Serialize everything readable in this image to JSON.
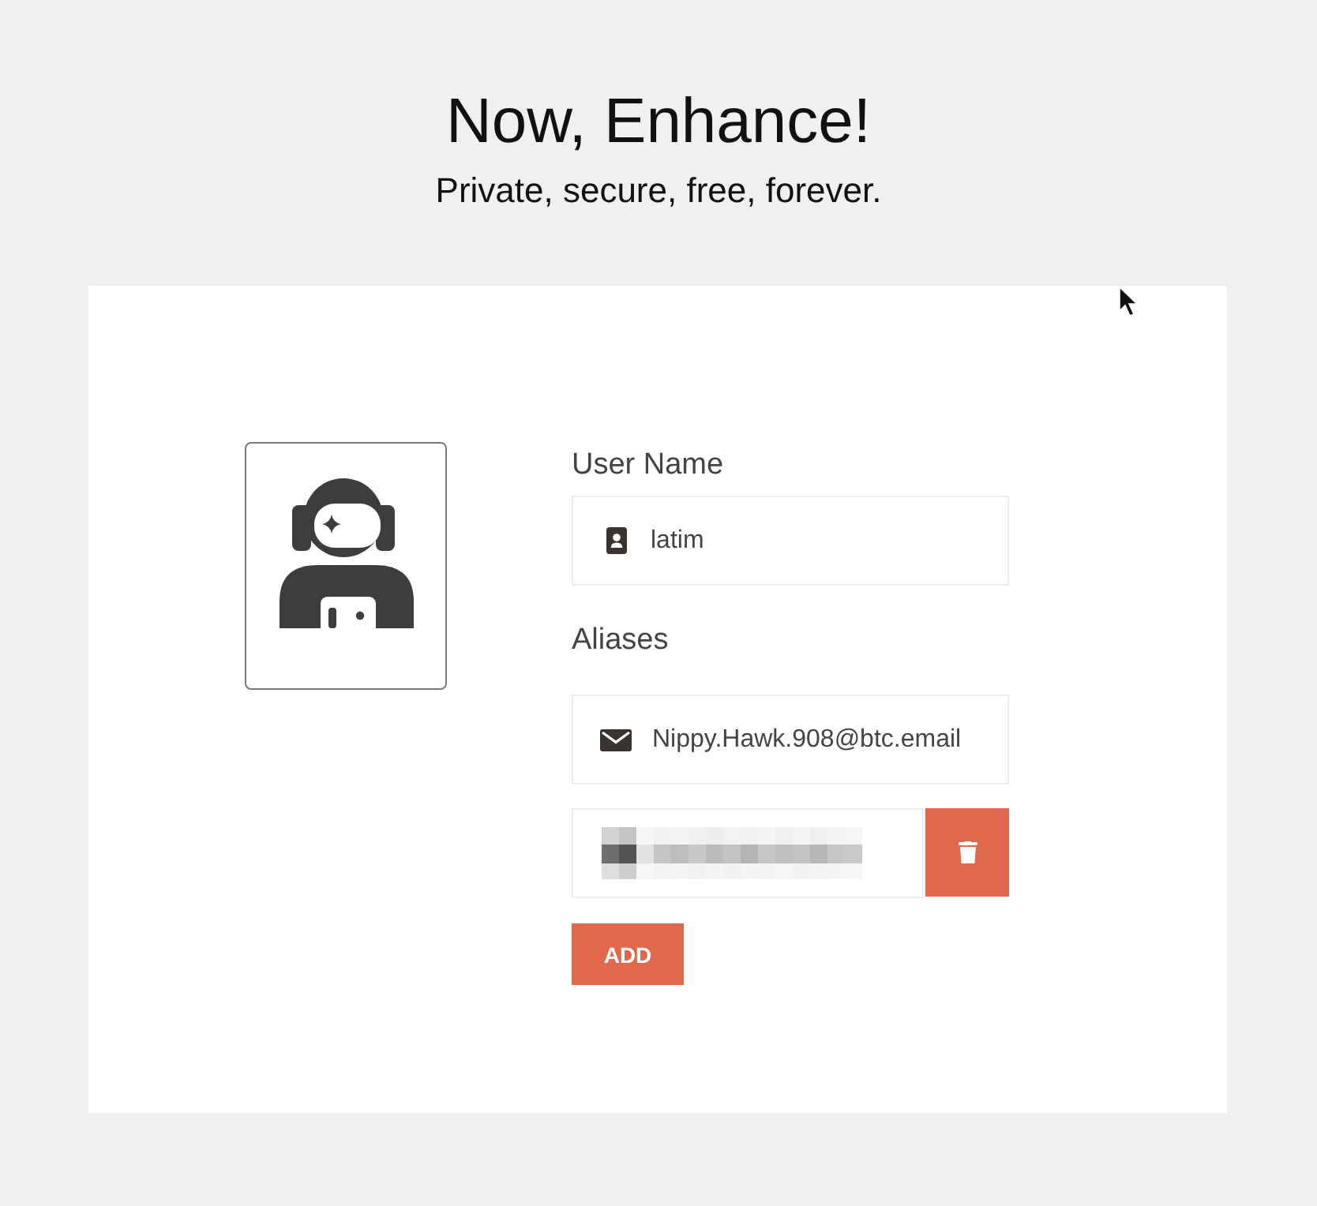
{
  "header": {
    "title": "Now, Enhance!",
    "subtitle": "Private, secure, free, forever."
  },
  "form": {
    "user_name": {
      "label": "User Name",
      "value": "latim"
    },
    "aliases": {
      "label": "Aliases",
      "items": [
        {
          "value": "Nippy.Hawk.908@btc.email",
          "redacted": false,
          "removable": false
        },
        {
          "redacted": true,
          "removable": true
        }
      ]
    },
    "add_button": "ADD"
  }
}
